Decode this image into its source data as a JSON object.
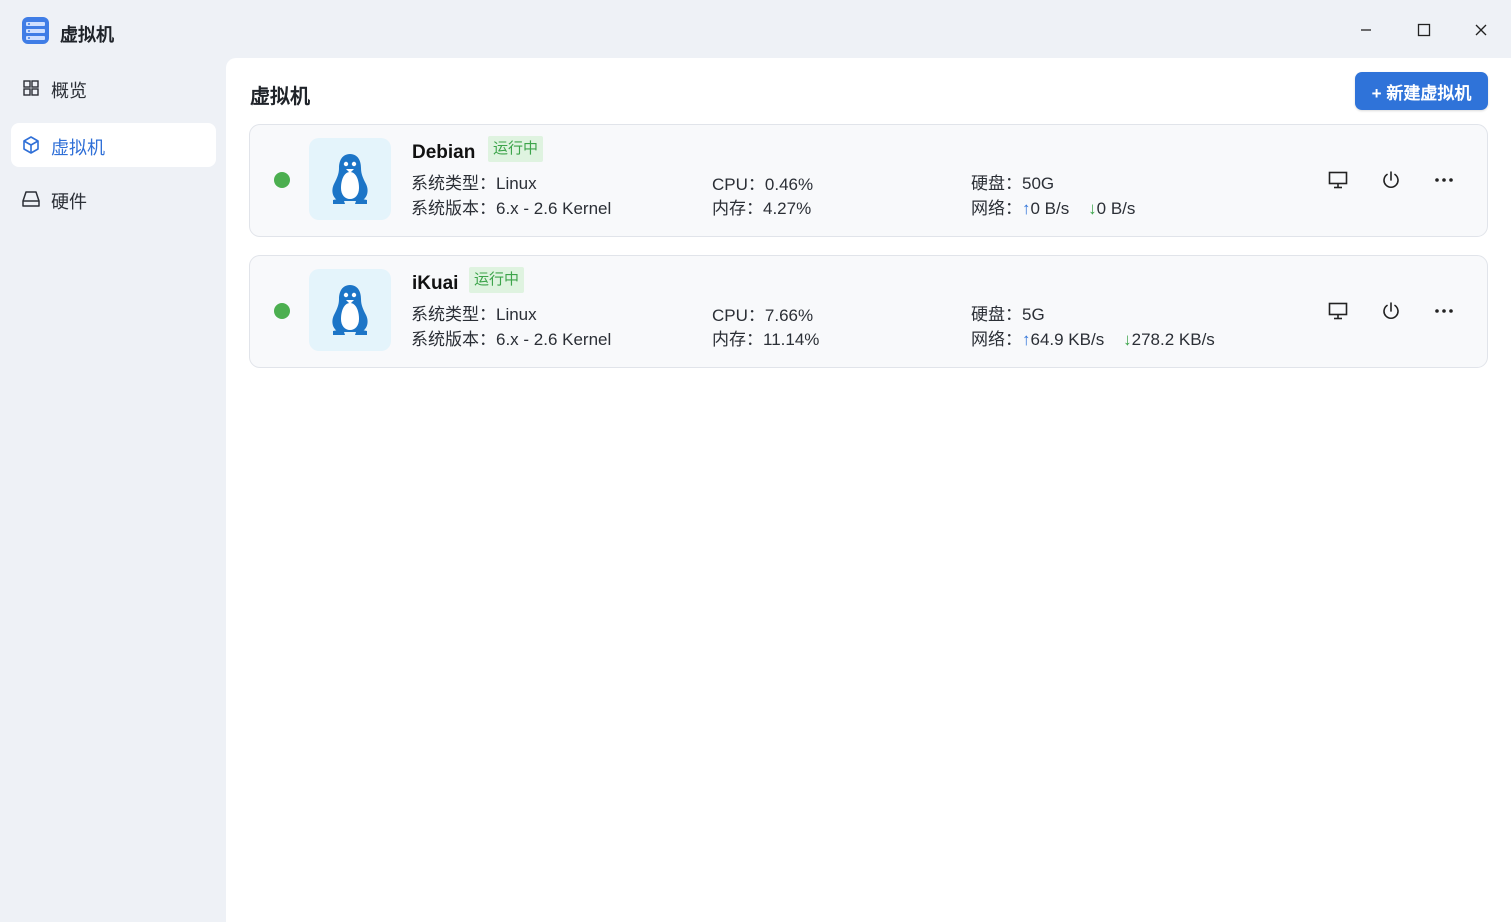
{
  "app": {
    "title": "虚拟机"
  },
  "sidebar": {
    "items": [
      {
        "label": "概览",
        "icon": "grid-icon",
        "active": false
      },
      {
        "label": "虚拟机",
        "icon": "cube-icon",
        "active": true
      },
      {
        "label": "硬件",
        "icon": "drive-icon",
        "active": false
      }
    ]
  },
  "main": {
    "title": "虚拟机",
    "new_button_label": "+ 新建虚拟机"
  },
  "labels": {
    "os_type": "系统类型：",
    "os_version": "系统版本：",
    "cpu": "CPU：",
    "memory": "内存：",
    "disk": "硬盘：",
    "network": "网络："
  },
  "vms": [
    {
      "name": "Debian",
      "status": "运行中",
      "os_type": "Linux",
      "os_version": "6.x - 2.6 Kernel",
      "cpu": "0.46%",
      "memory": "4.27%",
      "disk": "50G",
      "net_up": "0 B/s",
      "net_down": "0 B/s"
    },
    {
      "name": "iKuai",
      "status": "运行中",
      "os_type": "Linux",
      "os_version": "6.x - 2.6 Kernel",
      "cpu": "7.66%",
      "memory": "11.14%",
      "disk": "5G",
      "net_up": "64.9 KB/s",
      "net_down": "278.2 KB/s"
    }
  ],
  "colors": {
    "accent": "#2f73d9",
    "running": "#4caf50",
    "badge_bg": "#dff3e0",
    "badge_text": "#3ca44a"
  }
}
